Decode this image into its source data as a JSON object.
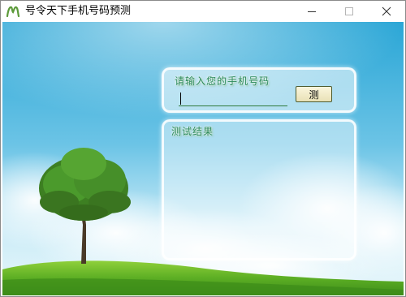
{
  "window": {
    "title": "号令天下手机号码预测",
    "controls": [
      "minimize-icon",
      "maximize-icon",
      "close-icon"
    ]
  },
  "form": {
    "prompt_label": "请输入您的手机号码",
    "phone_value": "",
    "test_button_label": "测"
  },
  "result": {
    "label": "测试结果",
    "content": ""
  },
  "colors": {
    "label_green": "#2a8a5a",
    "sky_top": "#2fa8d8",
    "grass": "#5fb52a"
  }
}
